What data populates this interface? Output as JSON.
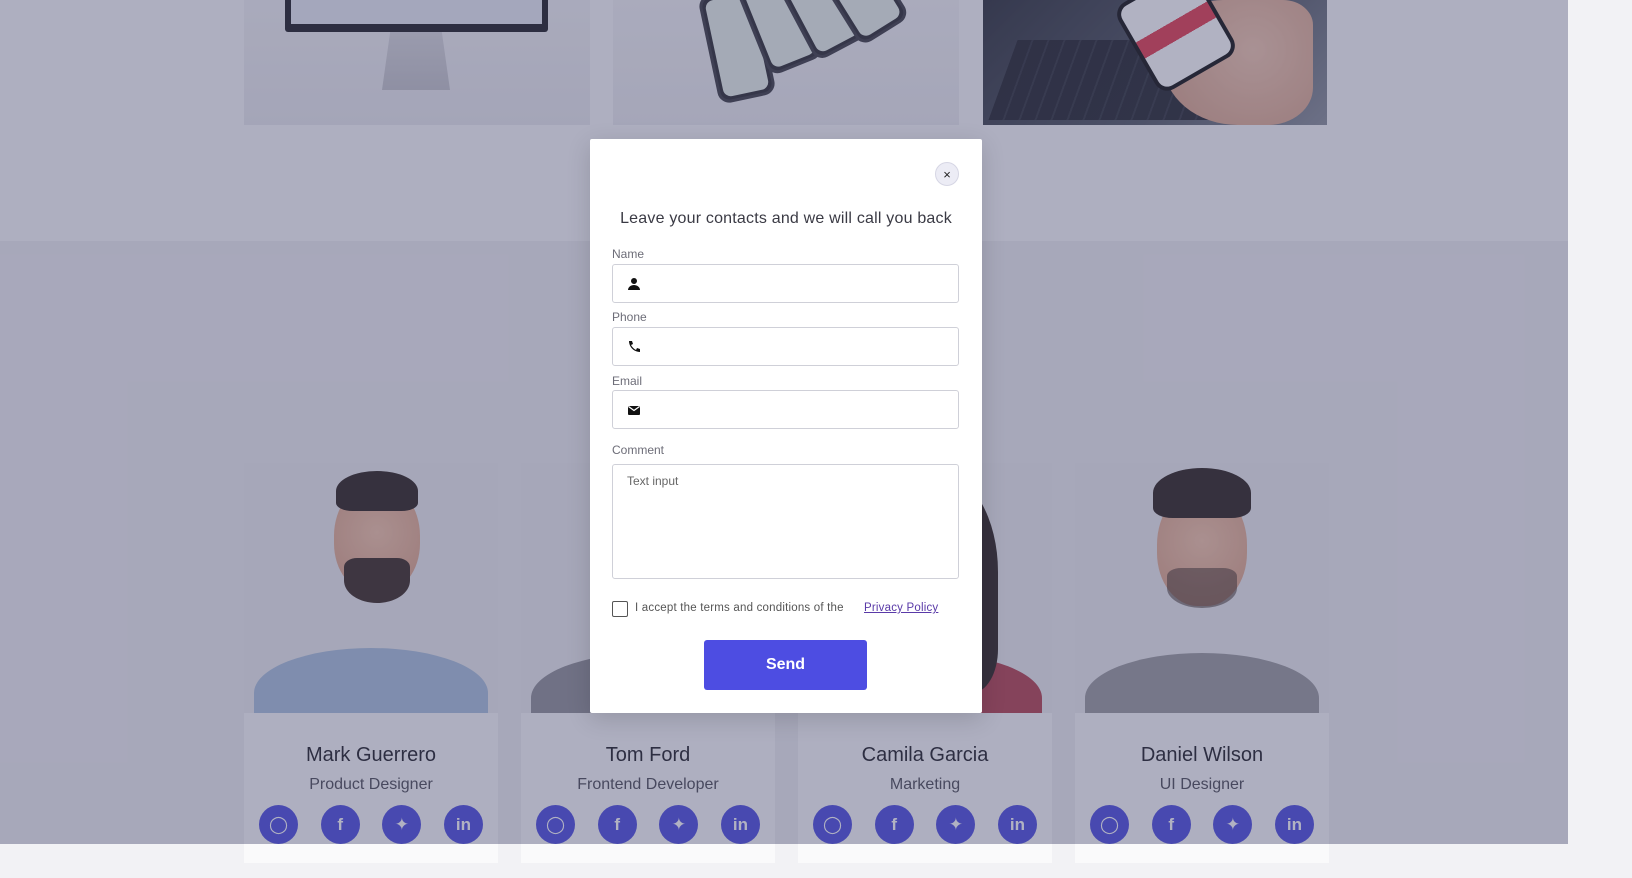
{
  "modal": {
    "close_label": "×",
    "title": "Leave your contacts and we will call you back",
    "fields": {
      "name": {
        "label": "Name",
        "value": "",
        "icon": "person-icon"
      },
      "phone": {
        "label": "Phone",
        "value": "",
        "icon": "phone-icon"
      },
      "email": {
        "label": "Email",
        "value": "",
        "icon": "mail-icon"
      },
      "comment": {
        "label": "Comment",
        "placeholder": "Text input",
        "value": ""
      }
    },
    "terms_text": "I accept the terms and conditions of the",
    "privacy_link": "Privacy Policy",
    "terms_checked": false,
    "send_label": "Send"
  },
  "team": [
    {
      "name": "Mark Guerrero",
      "role": "Product Designer"
    },
    {
      "name": "Tom Ford",
      "role": "Frontend Developer"
    },
    {
      "name": "Camila Garcia",
      "role": "Marketing"
    },
    {
      "name": "Daniel Wilson",
      "role": "UI Designer"
    }
  ],
  "social_icons": [
    "instagram-icon",
    "facebook-icon",
    "twitter-icon",
    "linkedin-icon"
  ],
  "colors": {
    "accent": "#4d4de2",
    "overlay": "rgba(70,72,110,0.42)",
    "link": "#5a3aa8"
  }
}
